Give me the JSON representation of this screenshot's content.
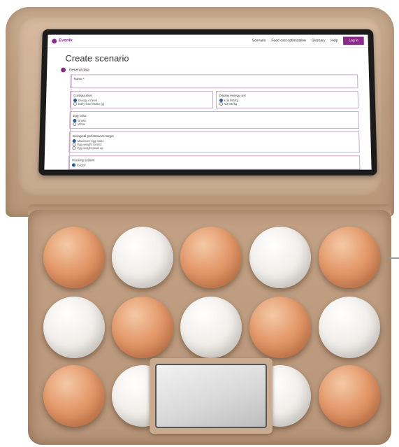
{
  "app": {
    "logo": "Evonik",
    "nav": [
      "Scenario",
      "Feed cost optimization",
      "Glossary",
      "Help"
    ],
    "login": "Log in"
  },
  "page": {
    "title": "Create scenario",
    "step": "General data"
  },
  "form": {
    "name_label": "Name *",
    "configuration": {
      "label": "Configuration",
      "options": [
        "Energy in feed",
        "Daily feed intake (g)"
      ],
      "selected": 0
    },
    "display_energy_unit": {
      "label": "Display energy unit",
      "options": [
        "kcal ME/kg",
        "MJ ME/kg"
      ],
      "selected": 0
    },
    "egg_color": {
      "label": "Egg color",
      "options": [
        "Brown",
        "White"
      ],
      "selected": 0
    },
    "biological_performance": {
      "label": "Biological performance target",
      "options": [
        "Maximum egg mass",
        "Egg weight control",
        "Egg weight peak up"
      ],
      "selected": 0
    },
    "housing_system": {
      "label": "Housing system",
      "options": [
        "Caged"
      ],
      "selected": 0
    }
  },
  "eggs": {
    "rows": [
      [
        "brown",
        "white",
        "brown",
        "white",
        "brown"
      ],
      [
        "white",
        "brown",
        "white",
        "brown",
        "white"
      ],
      [
        "brown",
        "white",
        "hidden",
        "white",
        "brown"
      ]
    ],
    "colors": {
      "brown": "#e49a6c",
      "white": "#f1eeea"
    }
  },
  "colors": {
    "accent": "#8a2a8a",
    "carton": "#c2a184",
    "monitor_frame": "#1b1b1b"
  }
}
